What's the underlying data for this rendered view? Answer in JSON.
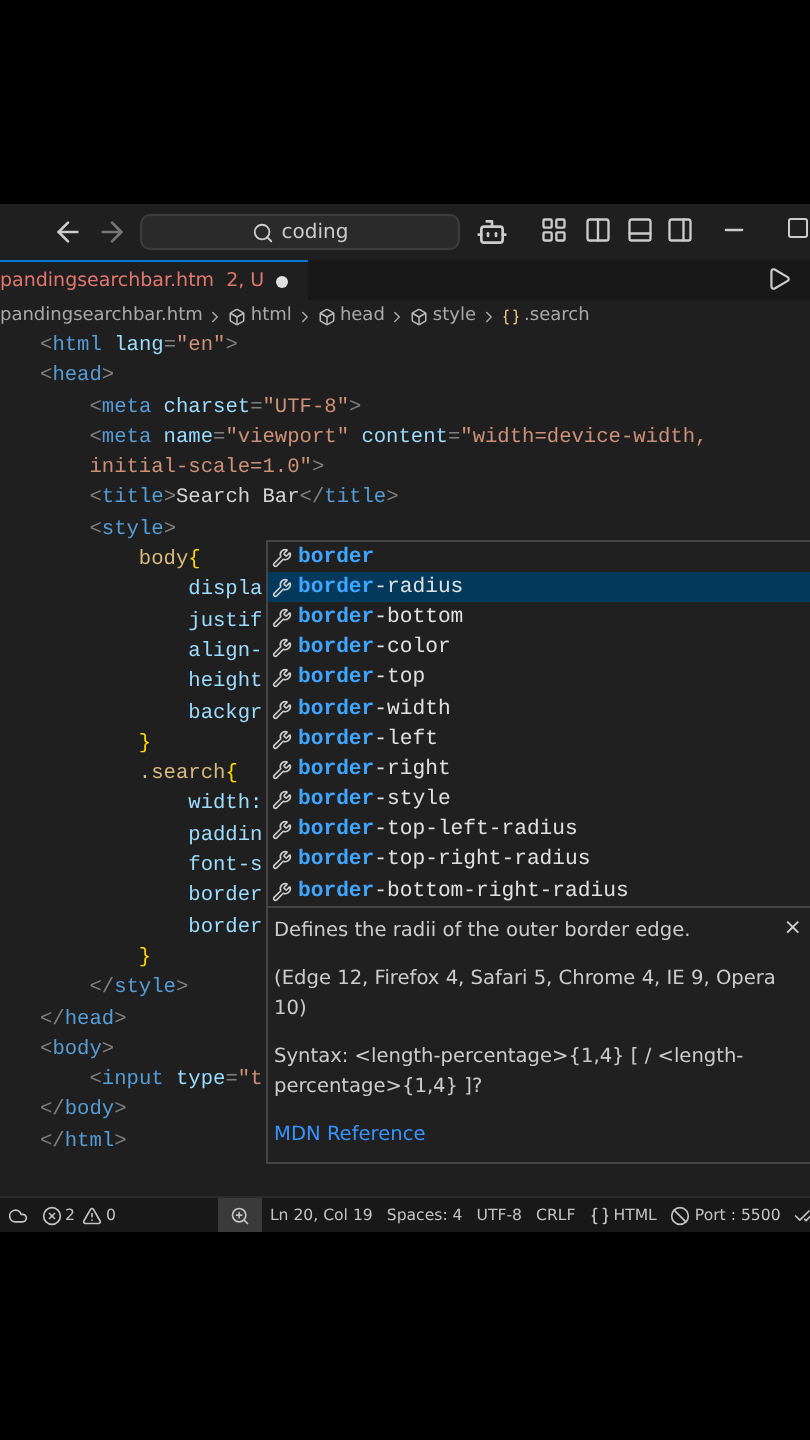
{
  "title_bar": {
    "search": "coding"
  },
  "tab": {
    "filename": "pandingsearchbar.htm",
    "problems": "2, U",
    "modified": true
  },
  "breadcrumbs": [
    {
      "label": "pandingsearchbar.htm",
      "kind": "file"
    },
    {
      "label": "html",
      "kind": "element"
    },
    {
      "label": "head",
      "kind": "element"
    },
    {
      "label": "style",
      "kind": "element"
    },
    {
      "label": ".search",
      "kind": "selector"
    }
  ],
  "code_lines": [
    [
      {
        "kind": "punct",
        "text": "<"
      },
      {
        "kind": "tag",
        "text": "html"
      },
      {
        "kind": "attr",
        "text": " lang"
      },
      {
        "kind": "punct",
        "text": "="
      },
      {
        "kind": "string",
        "text": "\"en\""
      },
      {
        "kind": "punct",
        "text": ">"
      }
    ],
    [
      {
        "kind": "punct",
        "text": "<"
      },
      {
        "kind": "tag",
        "text": "head"
      },
      {
        "kind": "punct",
        "text": ">"
      }
    ],
    [
      {
        "kind": "punct",
        "text": "    <"
      },
      {
        "kind": "tag",
        "text": "meta"
      },
      {
        "kind": "attr",
        "text": " charset"
      },
      {
        "kind": "punct",
        "text": "="
      },
      {
        "kind": "string",
        "text": "\"UTF-8\""
      },
      {
        "kind": "punct",
        "text": ">"
      }
    ],
    [
      {
        "kind": "punct",
        "text": "    <"
      },
      {
        "kind": "tag",
        "text": "meta"
      },
      {
        "kind": "attr",
        "text": " name"
      },
      {
        "kind": "punct",
        "text": "="
      },
      {
        "kind": "string",
        "text": "\"viewport\""
      },
      {
        "kind": "attr",
        "text": " content"
      },
      {
        "kind": "punct",
        "text": "="
      },
      {
        "kind": "string",
        "text": "\"width=device-width,"
      }
    ],
    [
      {
        "kind": "string",
        "text": "    initial-scale=1.0\""
      },
      {
        "kind": "punct",
        "text": ">"
      }
    ],
    [
      {
        "kind": "punct",
        "text": "    <"
      },
      {
        "kind": "tag",
        "text": "title"
      },
      {
        "kind": "punct",
        "text": ">"
      },
      {
        "kind": "plain",
        "text": "Search Bar"
      },
      {
        "kind": "punct",
        "text": "</"
      },
      {
        "kind": "tag",
        "text": "title"
      },
      {
        "kind": "punct",
        "text": ">"
      }
    ],
    [
      {
        "kind": "punct",
        "text": "    <"
      },
      {
        "kind": "tag",
        "text": "style"
      },
      {
        "kind": "punct",
        "text": ">"
      }
    ],
    [
      {
        "kind": "selector",
        "text": "        body"
      },
      {
        "kind": "brace",
        "text": "{"
      }
    ],
    [
      {
        "kind": "property",
        "text": "            displa"
      }
    ],
    [
      {
        "kind": "property",
        "text": "            justif"
      }
    ],
    [
      {
        "kind": "property",
        "text": "            align-"
      }
    ],
    [
      {
        "kind": "property",
        "text": "            height"
      }
    ],
    [
      {
        "kind": "property",
        "text": "            backgr"
      }
    ],
    [
      {
        "kind": "brace",
        "text": "        }"
      }
    ],
    [
      {
        "kind": "selector",
        "text": "        .search"
      },
      {
        "kind": "brace",
        "text": "{"
      }
    ],
    [
      {
        "kind": "property",
        "text": "            width:"
      }
    ],
    [
      {
        "kind": "property",
        "text": "            paddin"
      }
    ],
    [
      {
        "kind": "property",
        "text": "            font-s"
      }
    ],
    [
      {
        "kind": "property",
        "text": "            border"
      }
    ],
    [
      {
        "kind": "property",
        "text": "            border"
      }
    ],
    [
      {
        "kind": "brace",
        "text": "        }"
      }
    ],
    [
      {
        "kind": "punct",
        "text": "    </"
      },
      {
        "kind": "tag",
        "text": "style"
      },
      {
        "kind": "punct",
        "text": ">"
      }
    ],
    [
      {
        "kind": "punct",
        "text": "</"
      },
      {
        "kind": "tag",
        "text": "head"
      },
      {
        "kind": "punct",
        "text": ">"
      }
    ],
    [
      {
        "kind": "punct",
        "text": "<"
      },
      {
        "kind": "tag",
        "text": "body"
      },
      {
        "kind": "punct",
        "text": ">"
      }
    ],
    [
      {
        "kind": "punct",
        "text": "    <"
      },
      {
        "kind": "tag",
        "text": "input"
      },
      {
        "kind": "attr",
        "text": " type"
      },
      {
        "kind": "punct",
        "text": "="
      },
      {
        "kind": "string",
        "text": "\"t"
      }
    ],
    [
      {
        "kind": "punct",
        "text": "</"
      },
      {
        "kind": "tag",
        "text": "body"
      },
      {
        "kind": "punct",
        "text": ">"
      }
    ],
    [
      {
        "kind": "punct",
        "text": "</"
      },
      {
        "kind": "tag",
        "text": "html"
      },
      {
        "kind": "punct",
        "text": ">"
      }
    ]
  ],
  "suggestions": [
    {
      "match": "border",
      "selected": false
    },
    {
      "match": "border",
      "rest": "-radius",
      "selected": true
    },
    {
      "match": "border",
      "rest": "-bottom",
      "selected": false
    },
    {
      "match": "border",
      "rest": "-color",
      "selected": false
    },
    {
      "match": "border",
      "rest": "-top",
      "selected": false
    },
    {
      "match": "border",
      "rest": "-width",
      "selected": false
    },
    {
      "match": "border",
      "rest": "-left",
      "selected": false
    },
    {
      "match": "border",
      "rest": "-right",
      "selected": false
    },
    {
      "match": "border",
      "rest": "-style",
      "selected": false
    },
    {
      "match": "border",
      "rest": "-top-left-radius",
      "selected": false
    },
    {
      "match": "border",
      "rest": "-top-right-radius",
      "selected": false
    },
    {
      "match": "border",
      "rest": "-bottom-right-radius",
      "selected": false
    }
  ],
  "details": {
    "description": "Defines the radii of the outer border edge.",
    "close": "×",
    "compat": "(Edge 12, Firefox 4, Safari 5, Chrome 4, IE 9, Opera 10)",
    "syntax": "Syntax: <length-percentage>{1,4} [ / <length-percentage>{1,4} ]?",
    "link": "MDN Reference"
  },
  "status_bar": [
    {
      "kind": "remote"
    },
    {
      "kind": "errors",
      "text": "2"
    },
    {
      "kind": "warnings",
      "text": "0"
    },
    {
      "kind": "zoom"
    },
    {
      "kind": "text",
      "text": "Ln 20, Col 19"
    },
    {
      "kind": "text",
      "text": "Spaces: 4"
    },
    {
      "kind": "text",
      "text": "UTF-8"
    },
    {
      "kind": "text",
      "text": "CRLF"
    },
    {
      "kind": "language",
      "text": "HTML"
    },
    {
      "kind": "port",
      "text": "Port : 5500"
    },
    {
      "kind": "check"
    }
  ]
}
